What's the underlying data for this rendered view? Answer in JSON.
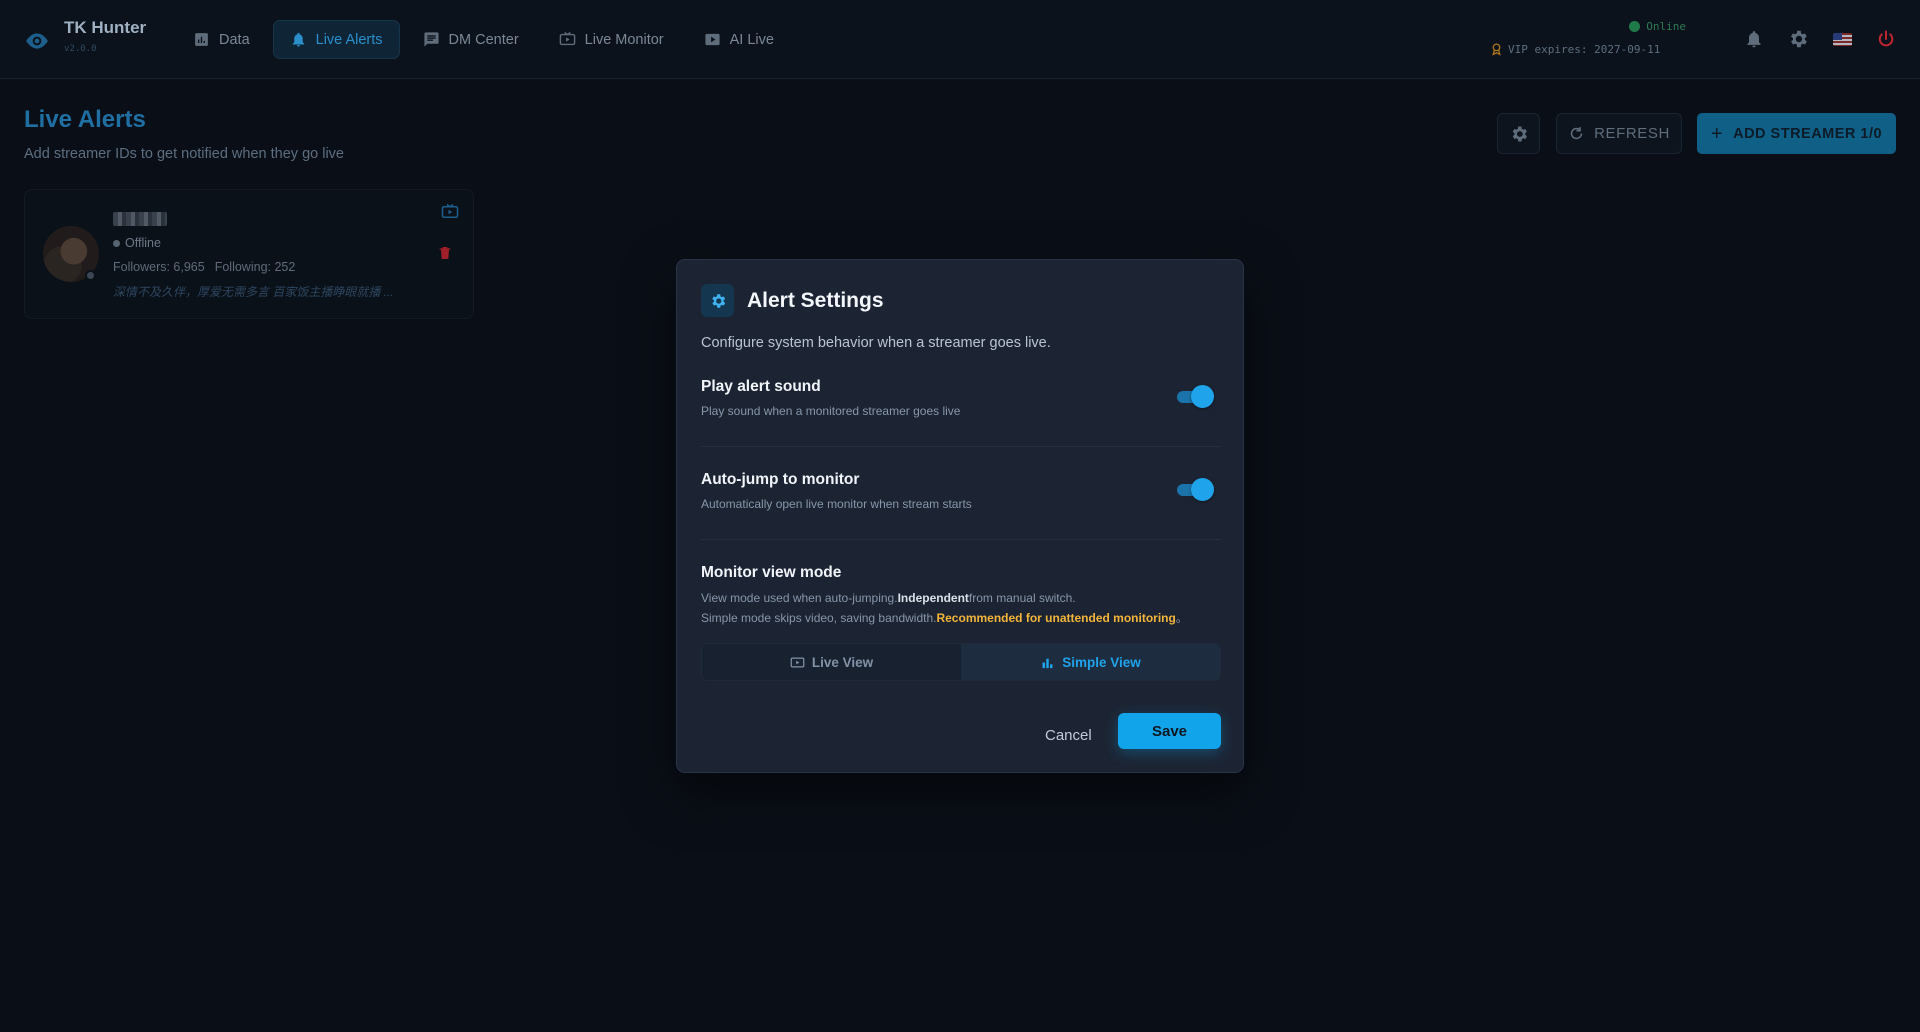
{
  "app": {
    "name": "TK Hunter",
    "version": "v2.0.0"
  },
  "nav": [
    {
      "label": "Data",
      "icon": "bar-chart-icon"
    },
    {
      "label": "Live Alerts",
      "icon": "bell-icon",
      "active": true
    },
    {
      "label": "DM Center",
      "icon": "message-icon"
    },
    {
      "label": "Live Monitor",
      "icon": "tv-icon"
    },
    {
      "label": "AI Live",
      "icon": "play-icon"
    }
  ],
  "status": {
    "online": "Online",
    "vip": "VIP expires: 2027-09-11"
  },
  "colors": {
    "accent": "#12a4ea",
    "danger": "#c0252f",
    "warning": "#f2b53a",
    "online": "#1f7a4a"
  },
  "page": {
    "title": "Live Alerts",
    "subtitle": "Add streamer IDs to get notified when they go live",
    "refresh_label": "REFRESH",
    "add_label": "ADD STREAMER 1/0"
  },
  "streamer": {
    "status": "Offline",
    "followers": "Followers: 6,965",
    "following": "Following: 252",
    "bio": "深情不及久伴，厚爱无需多言 百家饭主播睁眼就播 ..."
  },
  "modal": {
    "title": "Alert Settings",
    "description": "Configure system behavior when a streamer goes live.",
    "options": [
      {
        "title": "Play alert sound",
        "subtitle": "Play sound when a monitored streamer goes live",
        "enabled": true
      },
      {
        "title": "Auto-jump to monitor",
        "subtitle": "Automatically open live monitor when stream starts",
        "enabled": true
      }
    ],
    "mode": {
      "title": "Monitor view mode",
      "line1_a": "View mode used when auto-jumping.",
      "line1_b": "Independent",
      "line1_c": "from manual switch.",
      "line2_a": "Simple mode skips video, saving bandwidth.",
      "line2_b": "Recommended for unattended monitoring",
      "line2_c": "。",
      "live_label": "Live View",
      "simple_label": "Simple View",
      "selected": "Simple View"
    },
    "cancel_label": "Cancel",
    "save_label": "Save"
  }
}
